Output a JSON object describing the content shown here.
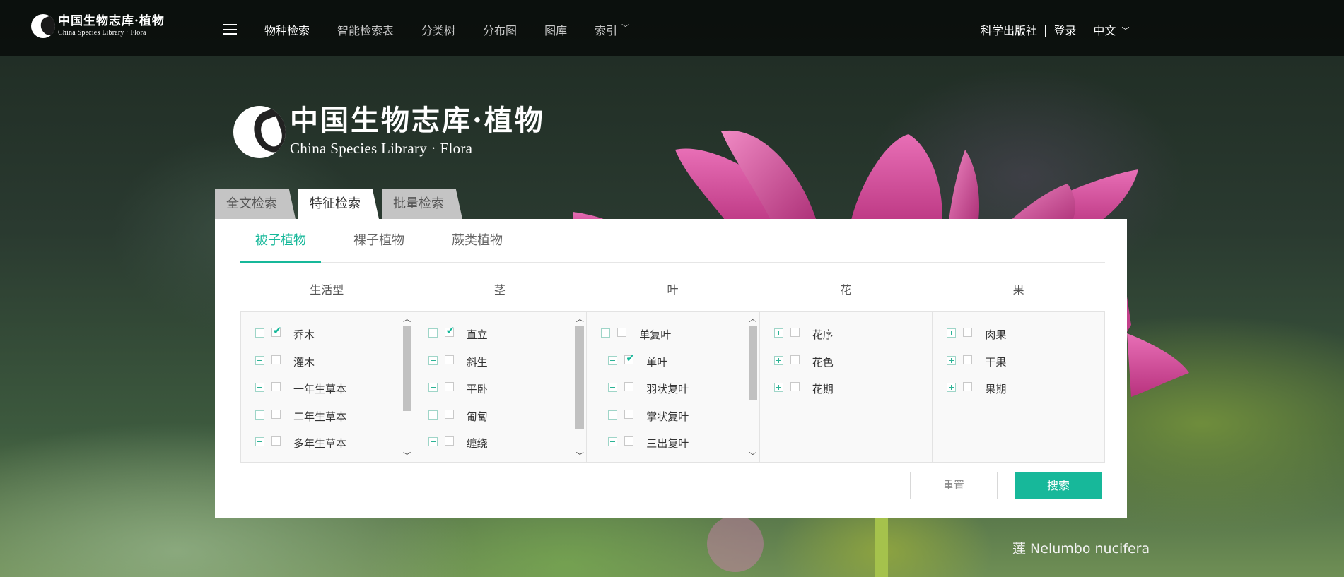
{
  "brand": {
    "logo_cn": "中国生物志库·植物",
    "logo_en": "China Species Library · Flora"
  },
  "nav": {
    "items": [
      "物种检索",
      "智能检索表",
      "分类树",
      "分布图",
      "图库",
      "索引"
    ],
    "publisher": "科学出版社",
    "separator": "|",
    "login": "登录",
    "language": "中文"
  },
  "search_tabs": [
    "全文检索",
    "特征检索",
    "批量检索"
  ],
  "plant_tabs": [
    "被子植物",
    "裸子植物",
    "蕨类植物"
  ],
  "columns": {
    "life_form": {
      "title": "生活型",
      "items": [
        {
          "label": "乔木",
          "checked": true
        },
        {
          "label": "灌木",
          "checked": false
        },
        {
          "label": "一年生草本",
          "checked": false
        },
        {
          "label": "二年生草本",
          "checked": false
        },
        {
          "label": "多年生草本",
          "checked": false
        }
      ]
    },
    "stem": {
      "title": "茎",
      "items": [
        {
          "label": "直立",
          "checked": true
        },
        {
          "label": "斜生",
          "checked": false
        },
        {
          "label": "平卧",
          "checked": false
        },
        {
          "label": "匍匐",
          "checked": false
        },
        {
          "label": "缠绕",
          "checked": false
        }
      ]
    },
    "leaf": {
      "title": "叶",
      "items": [
        {
          "label": "单复叶",
          "checked": false
        },
        {
          "label": "单叶",
          "checked": true
        },
        {
          "label": "羽状复叶",
          "checked": false
        },
        {
          "label": "掌状复叶",
          "checked": false
        },
        {
          "label": "三出复叶",
          "checked": false
        }
      ]
    },
    "flower": {
      "title": "花",
      "items": [
        {
          "label": "花序",
          "checked": false
        },
        {
          "label": "花色",
          "checked": false
        },
        {
          "label": "花期",
          "checked": false
        }
      ]
    },
    "fruit": {
      "title": "果",
      "items": [
        {
          "label": "肉果",
          "checked": false
        },
        {
          "label": "干果",
          "checked": false
        },
        {
          "label": "果期",
          "checked": false
        }
      ]
    }
  },
  "buttons": {
    "reset": "重置",
    "search": "搜索"
  },
  "caption": "莲 Nelumbo nucifera",
  "colors": {
    "accent": "#17b89a",
    "petal": "#d0509a"
  },
  "icons": {
    "menu": "hamburger-icon",
    "dropdown": "chevron-down-icon",
    "scroll_up": "chevron-up-icon",
    "scroll_down": "chevron-down-icon",
    "collapse": "minus-square-icon",
    "expand": "plus-square-icon",
    "checked": "check-icon"
  }
}
